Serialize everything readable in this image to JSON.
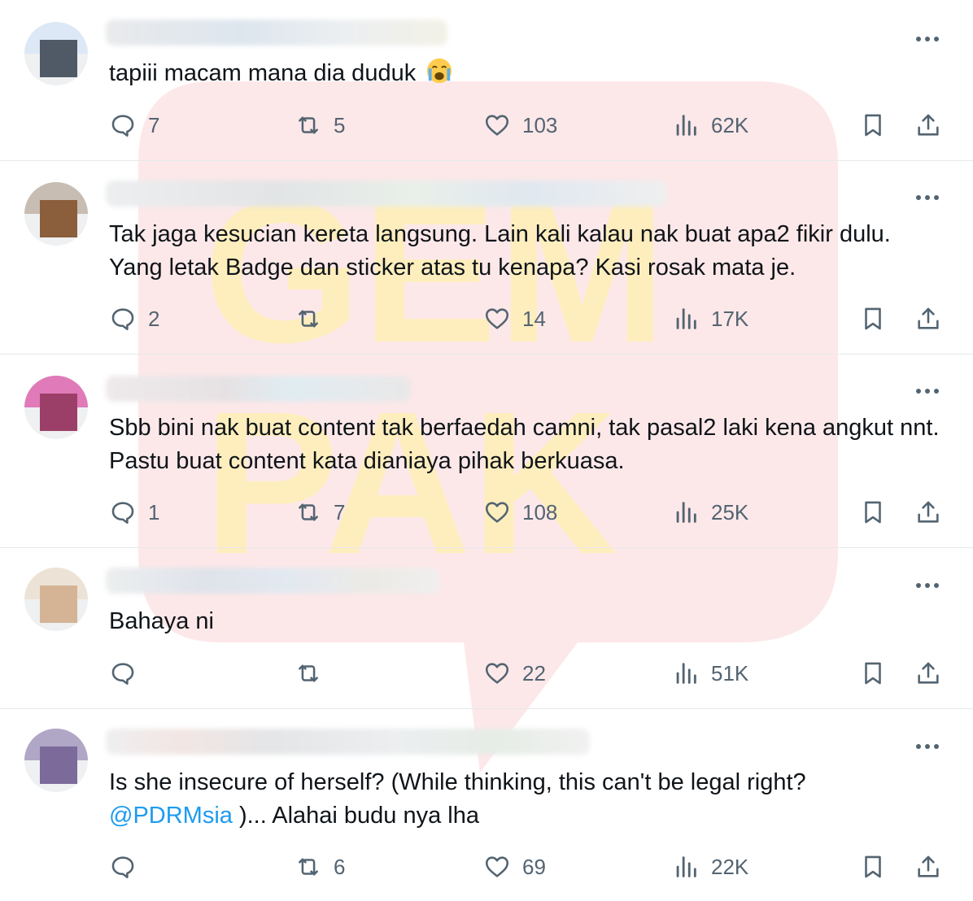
{
  "watermark": {
    "letters": [
      "GEM",
      "PAK"
    ]
  },
  "tweets": [
    {
      "text": "tapiii macam mana dia duduk",
      "emoji": "loudly-crying-face-emoji",
      "replies": "7",
      "reposts": "5",
      "likes": "103",
      "views": "62K",
      "avatar_colors": [
        "#dce8f5",
        "#505a66"
      ]
    },
    {
      "text": "Tak jaga kesucian kereta langsung. Lain kali kalau nak buat apa2 fikir dulu. Yang letak Badge dan sticker atas tu kenapa? Kasi rosak mata je.",
      "replies": "2",
      "reposts": "",
      "likes": "14",
      "views": "17K",
      "avatar_colors": [
        "#c7bdb3",
        "#8b5e3c"
      ]
    },
    {
      "text": "Sbb bini nak buat content tak berfaedah camni, tak pasal2 laki kena angkut nnt. Pastu buat content kata dianiaya pihak berkuasa.",
      "replies": "1",
      "reposts": "7",
      "likes": "108",
      "views": "25K",
      "avatar_colors": [
        "#e07ab8",
        "#9c3f68"
      ]
    },
    {
      "text": "Bahaya ni",
      "replies": "",
      "reposts": "",
      "likes": "22",
      "views": "51K",
      "avatar_colors": [
        "#ece3d6",
        "#d4b495"
      ]
    },
    {
      "text": "Is she insecure of herself? (While thinking, this can't be legal right?",
      "mention": "@PDRMsia",
      "text_after": ")... Alahai budu nya lha",
      "replies": "",
      "reposts": "6",
      "likes": "69",
      "views": "22K",
      "avatar_colors": [
        "#b0a6c6",
        "#7b6a9a"
      ]
    }
  ],
  "colors": {
    "text": "#0f1419",
    "secondary": "#536471",
    "link": "#1d9bf0",
    "divider": "#e6e9eb"
  }
}
